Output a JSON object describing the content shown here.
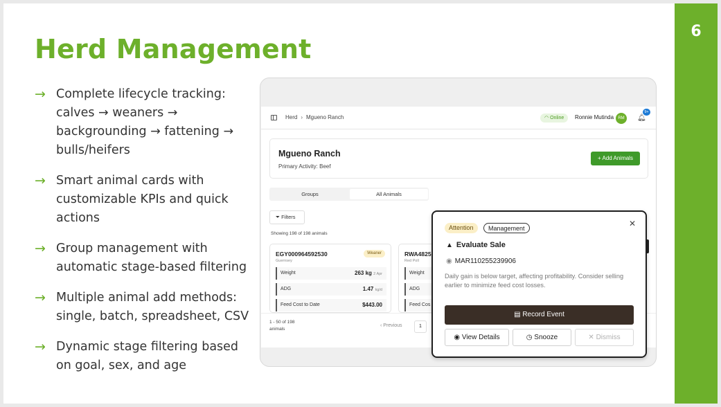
{
  "slide": {
    "title": "Herd Management",
    "page_number": "6",
    "bullets": [
      "Complete lifecycle tracking: calves → weaners → backgrounding → fattening → bulls/heifers",
      "Smart animal cards with customizable KPIs and quick actions",
      "Group management with automatic stage-based filtering",
      "Multiple animal add methods: single, batch, spreadsheet, CSV",
      "Dynamic stage filtering based on goal, sex, and age"
    ],
    "accent_color": "#6db02b"
  },
  "app": {
    "breadcrumb": [
      "Herd",
      "Mgueno Ranch"
    ],
    "status": "Online",
    "user_name": "Ronnie Mutinda",
    "avatar_initials": "RM",
    "notification_badge": "9+",
    "ranch": {
      "name": "Mgueno Ranch",
      "activity": "Primary Activity: Beef",
      "add_button": "Add Animals"
    },
    "tabs": [
      "Groups",
      "All Animals"
    ],
    "filters_label": "Filters",
    "showing_text": "Showing 198 of 198 animals",
    "cards": [
      {
        "tag": "EGY000964592530",
        "breed": "Guernsey",
        "stage": "Weaner",
        "rows": [
          {
            "label": "Weight",
            "value": "263 kg",
            "unit": "2 Apr"
          },
          {
            "label": "ADG",
            "value": "1.47",
            "unit": "kg/d"
          },
          {
            "label": "Feed Cost to Date",
            "value": "$443.00",
            "unit": ""
          }
        ]
      },
      {
        "tag": "RWA4825",
        "breed": "Red Poll",
        "stage": "",
        "rows": [
          {
            "label": "Weight",
            "value": "",
            "unit": ""
          },
          {
            "label": "ADG",
            "value": "",
            "unit": ""
          },
          {
            "label": "Feed Cos",
            "value": "",
            "unit": ""
          }
        ]
      }
    ],
    "pagination": {
      "count_text": "1 - 50 of 198 animals",
      "previous": "Previous",
      "current_page": "1"
    }
  },
  "popup": {
    "badges": [
      "Attention",
      "Management"
    ],
    "title": "Evaluate Sale",
    "animal_id": "MAR110255239906",
    "description": "Daily gain is below target, affecting profitability. Consider selling earlier to minimize feed cost losses.",
    "record_button": "Record Event",
    "view_button": "View Details",
    "snooze_button": "Snooze",
    "dismiss_button": "Dismiss"
  }
}
